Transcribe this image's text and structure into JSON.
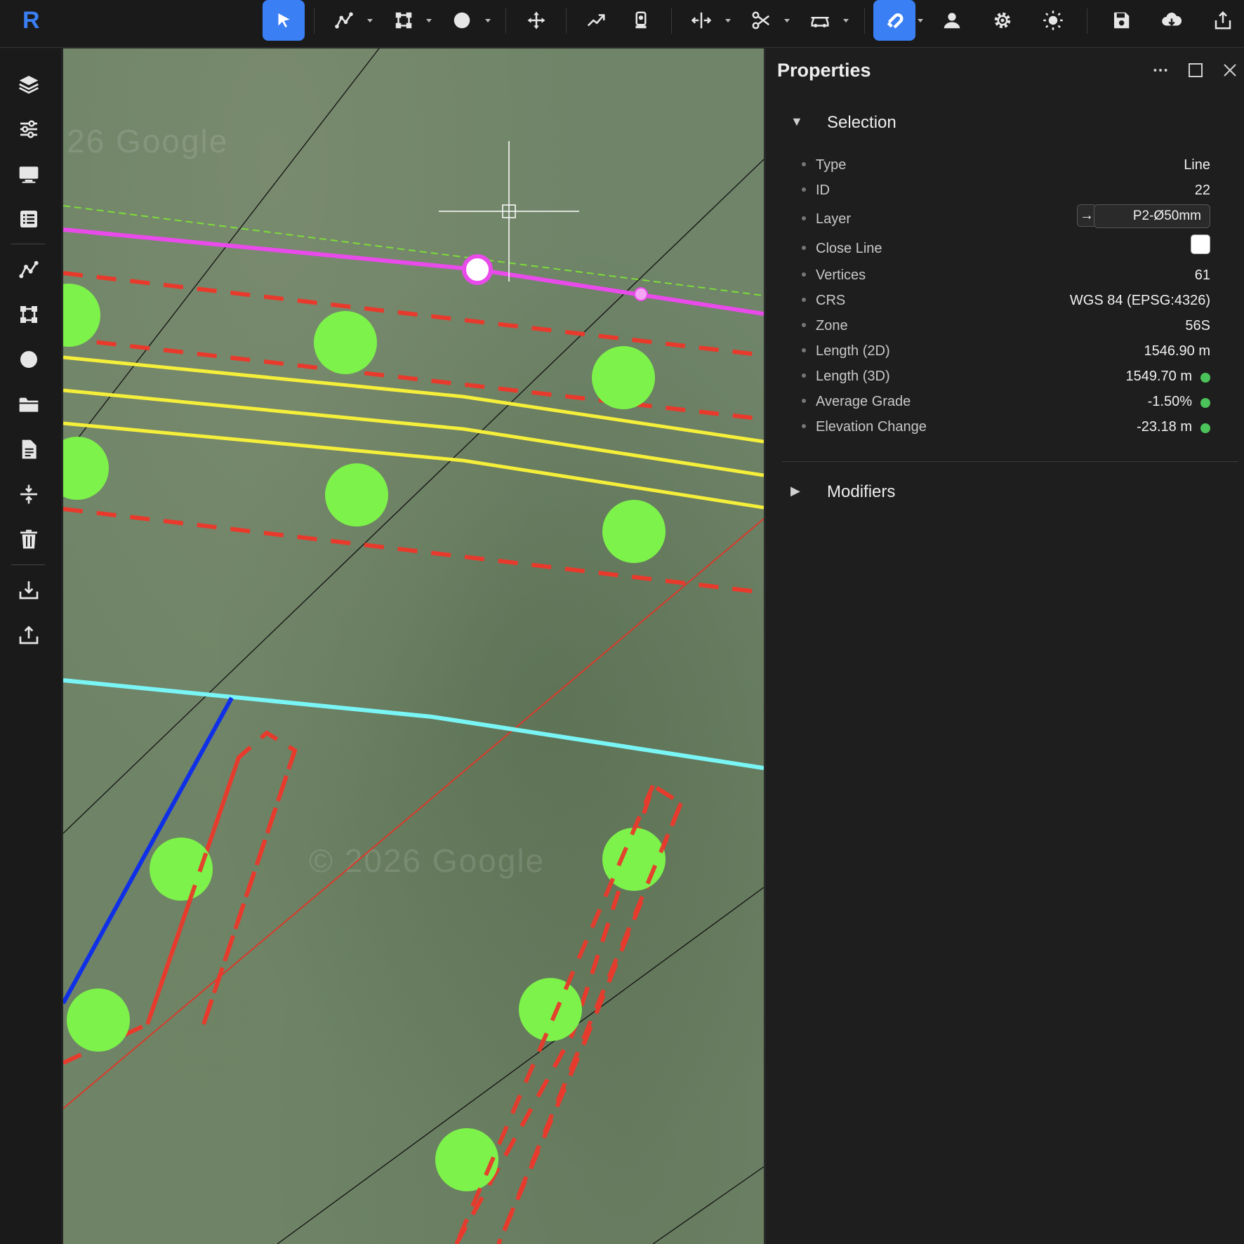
{
  "app": {
    "logo": "R"
  },
  "toolbar": {
    "buttons": [
      {
        "name": "select-tool",
        "icon": "cursor-arrow-icon",
        "active": true
      },
      {
        "name": "polyline-tool",
        "icon": "polyline-icon",
        "dropdown": true
      },
      {
        "name": "polygon-tool",
        "icon": "square-nodes-icon",
        "dropdown": true
      },
      {
        "name": "point-tool",
        "icon": "circle-icon",
        "dropdown": true
      },
      {
        "name": "move-tool",
        "icon": "move-arrows-icon"
      },
      {
        "name": "profile-tool",
        "icon": "trend-up-icon"
      },
      {
        "name": "survey-tool",
        "icon": "total-station-icon"
      },
      {
        "name": "split-tool",
        "icon": "split-arrows-icon",
        "dropdown": true
      },
      {
        "name": "cut-tool",
        "icon": "scissors-icon",
        "dropdown": true
      },
      {
        "name": "vehicle-tool",
        "icon": "vehicle-icon",
        "dropdown": true
      },
      {
        "name": "snap-tool",
        "icon": "magnet-icon",
        "dropdown": true,
        "active": true
      },
      {
        "name": "user-button",
        "icon": "user-icon"
      },
      {
        "name": "settings-button",
        "icon": "gear-icon"
      },
      {
        "name": "theme-button",
        "icon": "sun-icon"
      },
      {
        "name": "save-button",
        "icon": "save-disk-icon"
      },
      {
        "name": "cloud-download-button",
        "icon": "cloud-download-icon"
      },
      {
        "name": "export-button",
        "icon": "share-upload-icon"
      }
    ]
  },
  "sidebar": {
    "items": [
      {
        "name": "layers",
        "icon": "layers-icon"
      },
      {
        "name": "adjustments",
        "icon": "sliders-icon"
      },
      {
        "name": "display",
        "icon": "monitor-icon"
      },
      {
        "name": "table",
        "icon": "list-table-icon"
      },
      {
        "name": "draw-line",
        "icon": "polyline-icon"
      },
      {
        "name": "draw-polygon",
        "icon": "square-nodes-icon"
      },
      {
        "name": "draw-point",
        "icon": "circle-icon"
      },
      {
        "name": "open-folder",
        "icon": "folder-icon"
      },
      {
        "name": "document",
        "icon": "document-icon"
      },
      {
        "name": "merge",
        "icon": "compress-vertical-icon"
      },
      {
        "name": "delete",
        "icon": "trash-icon"
      },
      {
        "name": "import",
        "icon": "download-tray-icon"
      },
      {
        "name": "export",
        "icon": "upload-tray-icon"
      }
    ]
  },
  "map": {
    "watermark": "© 2026 Google",
    "watermark_top": "26 Google",
    "colors": {
      "selected_line": "#e94bea",
      "dashed_offset": "#e83a2c",
      "yellow_lines": "#f5ef3a",
      "cyan_line": "#7af5f5",
      "blue_line": "#1030e8",
      "green_circles": "#7df24a",
      "guide_green": "#7ddc3a",
      "thin_red": "#d83a2a",
      "black_lines": "#111111"
    }
  },
  "panel": {
    "title": "Properties",
    "selection": {
      "heading": "Selection",
      "expanded": true,
      "type_label": "Type",
      "type_value": "Line",
      "id_label": "ID",
      "id_value": "22",
      "layer_label": "Layer",
      "layer_arrow": "→",
      "layer_value": "P2-Ø50mm",
      "close_line_label": "Close Line",
      "close_line_checked": false,
      "vertices_label": "Vertices",
      "vertices_value": "61",
      "crs_label": "CRS",
      "crs_value": "WGS 84 (EPSG:4326)",
      "zone_label": "Zone",
      "zone_value": "56S",
      "length2d_label": "Length (2D)",
      "length2d_value": "1546.90 m",
      "length3d_label": "Length (3D)",
      "length3d_value": "1549.70 m",
      "grade_label": "Average Grade",
      "grade_value": "-1.50%",
      "elev_label": "Elevation Change",
      "elev_value": "-23.18 m"
    },
    "modifiers": {
      "heading": "Modifiers",
      "expanded": false
    }
  }
}
